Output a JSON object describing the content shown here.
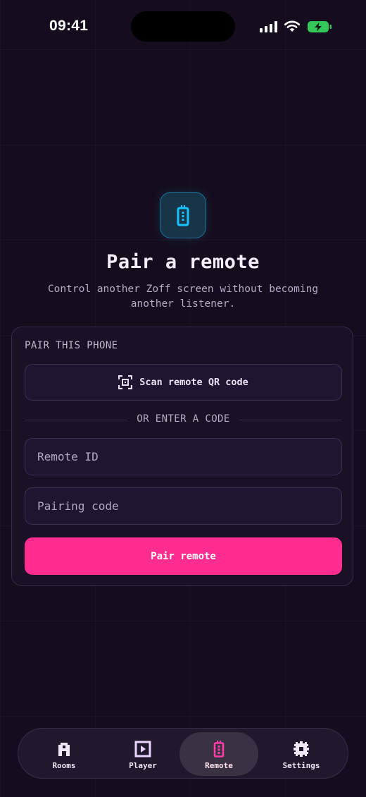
{
  "status_bar": {
    "time": "09:41"
  },
  "hero": {
    "icon": "remote-icon",
    "title": "Pair a remote",
    "subtitle": "Control another Zoff screen without becoming another listener."
  },
  "card": {
    "section_label": "PAIR THIS PHONE",
    "scan_button": {
      "icon": "qr-scan-icon",
      "label": "Scan remote QR code"
    },
    "divider_text": "OR ENTER A CODE",
    "remote_id": {
      "placeholder": "Remote ID",
      "value": ""
    },
    "pairing_code": {
      "placeholder": "Pairing code",
      "value": ""
    },
    "pair_button": "Pair remote"
  },
  "tab_bar": {
    "tabs": [
      {
        "label": "Rooms",
        "icon": "rooms-icon",
        "active": false
      },
      {
        "label": "Player",
        "icon": "player-icon",
        "active": false
      },
      {
        "label": "Remote",
        "icon": "remote-icon",
        "active": true
      },
      {
        "label": "Settings",
        "icon": "settings-gear-icon",
        "active": false
      }
    ]
  },
  "colors": {
    "background": "#150d1d",
    "accent": "#ff2d8f",
    "hero_icon": "#19c2ff",
    "active_tab_icon": "#ff3da8"
  }
}
